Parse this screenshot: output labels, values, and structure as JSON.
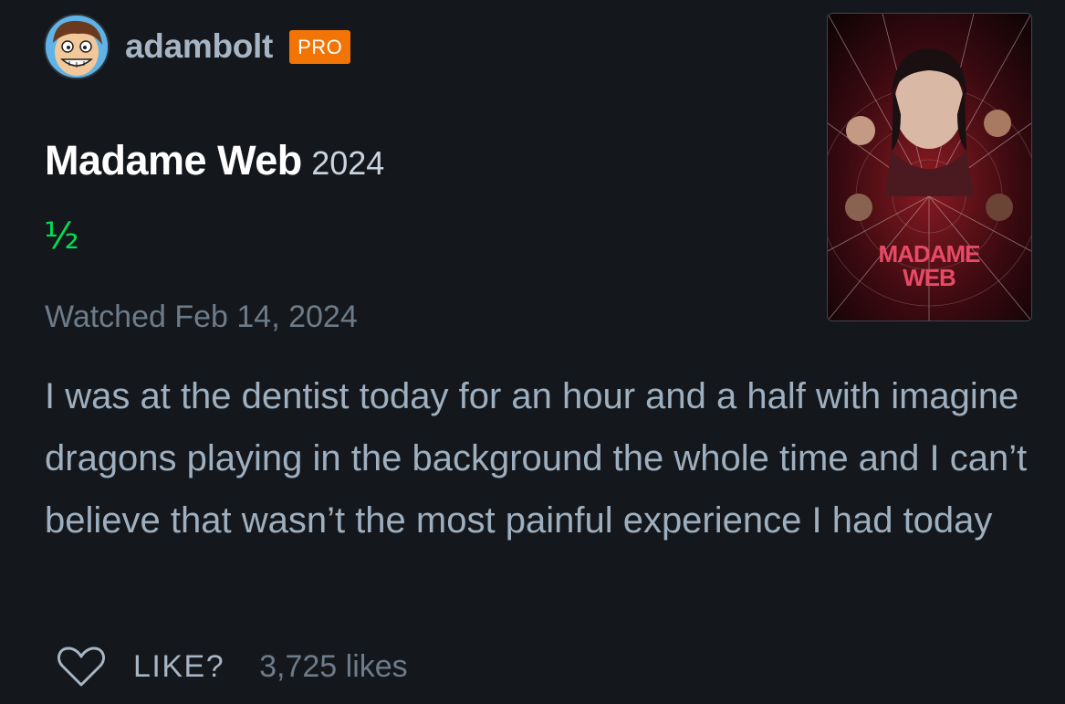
{
  "user": {
    "username": "adambolt",
    "badge": "PRO",
    "badge_color": "#f27405"
  },
  "film": {
    "title": "Madame Web",
    "year": "2024",
    "poster_title_line1": "MADAME",
    "poster_title_line2": "WEB"
  },
  "review": {
    "rating": "½",
    "rating_color": "#00e054",
    "watched": "Watched Feb 14, 2024",
    "text": "I was at the dentist today for an hour and a half with imagine dragons playing in the background the whole time and I can’t believe that wasn’t the most painful experience I had today"
  },
  "actions": {
    "like_label": "LIKE?",
    "like_icon": "heart-outline-icon",
    "like_count": "3,725 likes"
  }
}
